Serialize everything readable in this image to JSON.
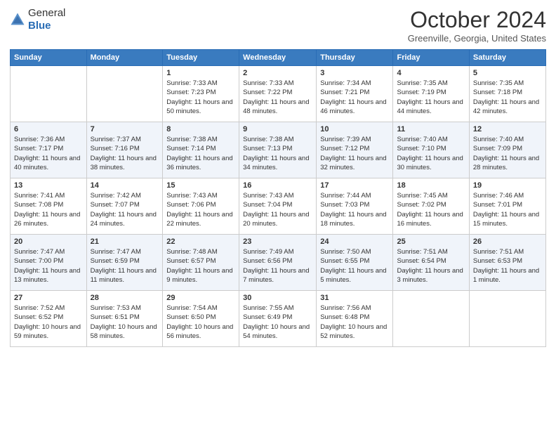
{
  "logo": {
    "general": "General",
    "blue": "Blue"
  },
  "title": "October 2024",
  "location": "Greenville, Georgia, United States",
  "days_of_week": [
    "Sunday",
    "Monday",
    "Tuesday",
    "Wednesday",
    "Thursday",
    "Friday",
    "Saturday"
  ],
  "weeks": [
    [
      {
        "day": "",
        "sunrise": "",
        "sunset": "",
        "daylight": ""
      },
      {
        "day": "",
        "sunrise": "",
        "sunset": "",
        "daylight": ""
      },
      {
        "day": "1",
        "sunrise": "Sunrise: 7:33 AM",
        "sunset": "Sunset: 7:23 PM",
        "daylight": "Daylight: 11 hours and 50 minutes."
      },
      {
        "day": "2",
        "sunrise": "Sunrise: 7:33 AM",
        "sunset": "Sunset: 7:22 PM",
        "daylight": "Daylight: 11 hours and 48 minutes."
      },
      {
        "day": "3",
        "sunrise": "Sunrise: 7:34 AM",
        "sunset": "Sunset: 7:21 PM",
        "daylight": "Daylight: 11 hours and 46 minutes."
      },
      {
        "day": "4",
        "sunrise": "Sunrise: 7:35 AM",
        "sunset": "Sunset: 7:19 PM",
        "daylight": "Daylight: 11 hours and 44 minutes."
      },
      {
        "day": "5",
        "sunrise": "Sunrise: 7:35 AM",
        "sunset": "Sunset: 7:18 PM",
        "daylight": "Daylight: 11 hours and 42 minutes."
      }
    ],
    [
      {
        "day": "6",
        "sunrise": "Sunrise: 7:36 AM",
        "sunset": "Sunset: 7:17 PM",
        "daylight": "Daylight: 11 hours and 40 minutes."
      },
      {
        "day": "7",
        "sunrise": "Sunrise: 7:37 AM",
        "sunset": "Sunset: 7:16 PM",
        "daylight": "Daylight: 11 hours and 38 minutes."
      },
      {
        "day": "8",
        "sunrise": "Sunrise: 7:38 AM",
        "sunset": "Sunset: 7:14 PM",
        "daylight": "Daylight: 11 hours and 36 minutes."
      },
      {
        "day": "9",
        "sunrise": "Sunrise: 7:38 AM",
        "sunset": "Sunset: 7:13 PM",
        "daylight": "Daylight: 11 hours and 34 minutes."
      },
      {
        "day": "10",
        "sunrise": "Sunrise: 7:39 AM",
        "sunset": "Sunset: 7:12 PM",
        "daylight": "Daylight: 11 hours and 32 minutes."
      },
      {
        "day": "11",
        "sunrise": "Sunrise: 7:40 AM",
        "sunset": "Sunset: 7:10 PM",
        "daylight": "Daylight: 11 hours and 30 minutes."
      },
      {
        "day": "12",
        "sunrise": "Sunrise: 7:40 AM",
        "sunset": "Sunset: 7:09 PM",
        "daylight": "Daylight: 11 hours and 28 minutes."
      }
    ],
    [
      {
        "day": "13",
        "sunrise": "Sunrise: 7:41 AM",
        "sunset": "Sunset: 7:08 PM",
        "daylight": "Daylight: 11 hours and 26 minutes."
      },
      {
        "day": "14",
        "sunrise": "Sunrise: 7:42 AM",
        "sunset": "Sunset: 7:07 PM",
        "daylight": "Daylight: 11 hours and 24 minutes."
      },
      {
        "day": "15",
        "sunrise": "Sunrise: 7:43 AM",
        "sunset": "Sunset: 7:06 PM",
        "daylight": "Daylight: 11 hours and 22 minutes."
      },
      {
        "day": "16",
        "sunrise": "Sunrise: 7:43 AM",
        "sunset": "Sunset: 7:04 PM",
        "daylight": "Daylight: 11 hours and 20 minutes."
      },
      {
        "day": "17",
        "sunrise": "Sunrise: 7:44 AM",
        "sunset": "Sunset: 7:03 PM",
        "daylight": "Daylight: 11 hours and 18 minutes."
      },
      {
        "day": "18",
        "sunrise": "Sunrise: 7:45 AM",
        "sunset": "Sunset: 7:02 PM",
        "daylight": "Daylight: 11 hours and 16 minutes."
      },
      {
        "day": "19",
        "sunrise": "Sunrise: 7:46 AM",
        "sunset": "Sunset: 7:01 PM",
        "daylight": "Daylight: 11 hours and 15 minutes."
      }
    ],
    [
      {
        "day": "20",
        "sunrise": "Sunrise: 7:47 AM",
        "sunset": "Sunset: 7:00 PM",
        "daylight": "Daylight: 11 hours and 13 minutes."
      },
      {
        "day": "21",
        "sunrise": "Sunrise: 7:47 AM",
        "sunset": "Sunset: 6:59 PM",
        "daylight": "Daylight: 11 hours and 11 minutes."
      },
      {
        "day": "22",
        "sunrise": "Sunrise: 7:48 AM",
        "sunset": "Sunset: 6:57 PM",
        "daylight": "Daylight: 11 hours and 9 minutes."
      },
      {
        "day": "23",
        "sunrise": "Sunrise: 7:49 AM",
        "sunset": "Sunset: 6:56 PM",
        "daylight": "Daylight: 11 hours and 7 minutes."
      },
      {
        "day": "24",
        "sunrise": "Sunrise: 7:50 AM",
        "sunset": "Sunset: 6:55 PM",
        "daylight": "Daylight: 11 hours and 5 minutes."
      },
      {
        "day": "25",
        "sunrise": "Sunrise: 7:51 AM",
        "sunset": "Sunset: 6:54 PM",
        "daylight": "Daylight: 11 hours and 3 minutes."
      },
      {
        "day": "26",
        "sunrise": "Sunrise: 7:51 AM",
        "sunset": "Sunset: 6:53 PM",
        "daylight": "Daylight: 11 hours and 1 minute."
      }
    ],
    [
      {
        "day": "27",
        "sunrise": "Sunrise: 7:52 AM",
        "sunset": "Sunset: 6:52 PM",
        "daylight": "Daylight: 10 hours and 59 minutes."
      },
      {
        "day": "28",
        "sunrise": "Sunrise: 7:53 AM",
        "sunset": "Sunset: 6:51 PM",
        "daylight": "Daylight: 10 hours and 58 minutes."
      },
      {
        "day": "29",
        "sunrise": "Sunrise: 7:54 AM",
        "sunset": "Sunset: 6:50 PM",
        "daylight": "Daylight: 10 hours and 56 minutes."
      },
      {
        "day": "30",
        "sunrise": "Sunrise: 7:55 AM",
        "sunset": "Sunset: 6:49 PM",
        "daylight": "Daylight: 10 hours and 54 minutes."
      },
      {
        "day": "31",
        "sunrise": "Sunrise: 7:56 AM",
        "sunset": "Sunset: 6:48 PM",
        "daylight": "Daylight: 10 hours and 52 minutes."
      },
      {
        "day": "",
        "sunrise": "",
        "sunset": "",
        "daylight": ""
      },
      {
        "day": "",
        "sunrise": "",
        "sunset": "",
        "daylight": ""
      }
    ]
  ]
}
